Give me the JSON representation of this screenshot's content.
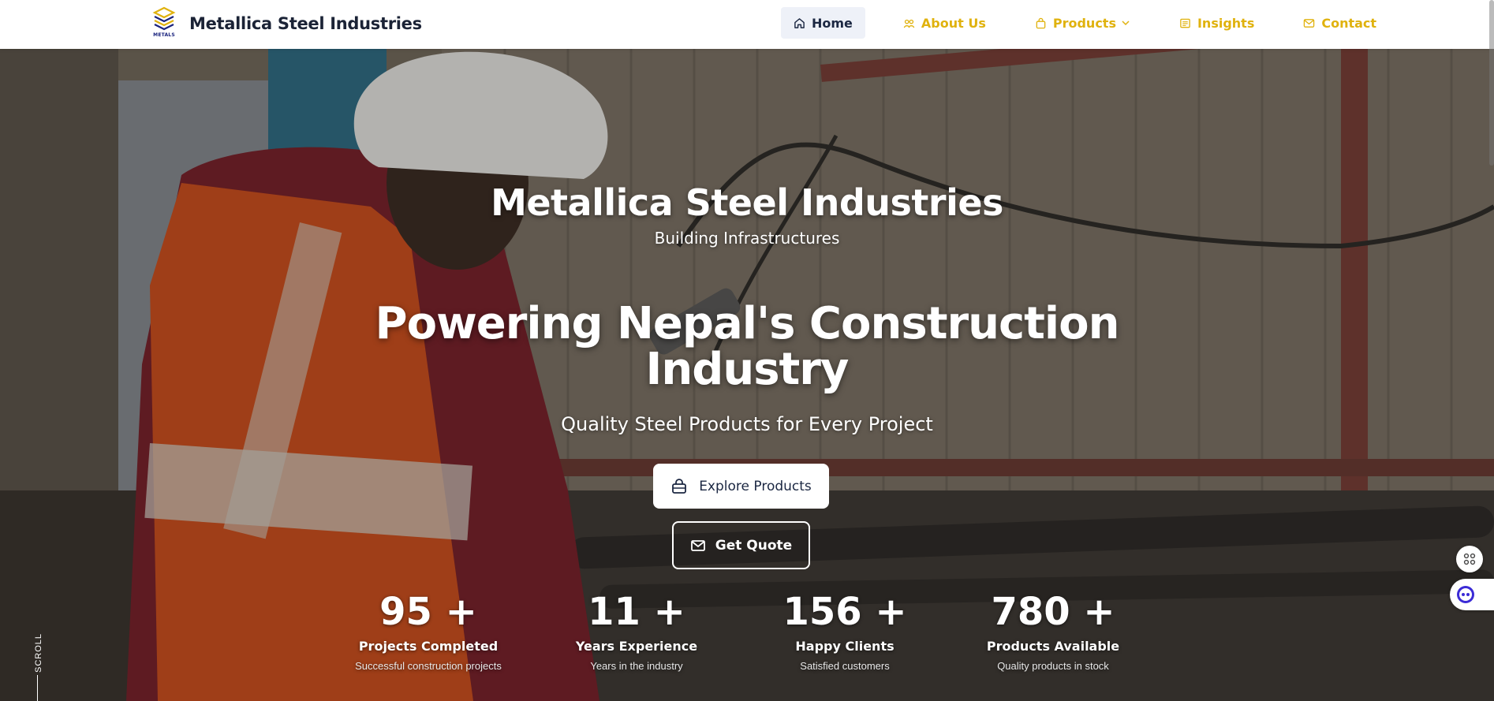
{
  "brand": {
    "name": "Metallica Steel Industries",
    "logo_text": "METALS"
  },
  "nav": {
    "items": [
      {
        "label": "Home",
        "icon": "home-icon",
        "active": true
      },
      {
        "label": "About Us",
        "icon": "about-icon",
        "active": false
      },
      {
        "label": "Products",
        "icon": "bag-icon",
        "active": false,
        "dropdown": true
      },
      {
        "label": "Insights",
        "icon": "insights-icon",
        "active": false
      },
      {
        "label": "Contact",
        "icon": "mail-icon",
        "active": false
      }
    ]
  },
  "hero": {
    "company_title": "Metallica Steel Industries",
    "company_subtitle": "Building Infrastructures",
    "headline_line1": "Powering Nepal's Construction",
    "headline_line2": "Industry",
    "tagline": "Quality Steel Products for Every Project",
    "explore_label": "Explore Products",
    "quote_label": "Get Quote",
    "scroll_label": "SCROLL"
  },
  "stats": [
    {
      "number": "95 +",
      "label": "Projects Completed",
      "desc": "Successful construction projects"
    },
    {
      "number": "11 +",
      "label": "Years Experience",
      "desc": "Years in the industry"
    },
    {
      "number": "156 +",
      "label": "Happy Clients",
      "desc": "Satisfied customers"
    },
    {
      "number": "780 +",
      "label": "Products Available",
      "desc": "Quality products in stock"
    }
  ],
  "colors": {
    "accent": "#e0b20e",
    "navy": "#1b2742",
    "active_bg": "#eef1f8"
  }
}
